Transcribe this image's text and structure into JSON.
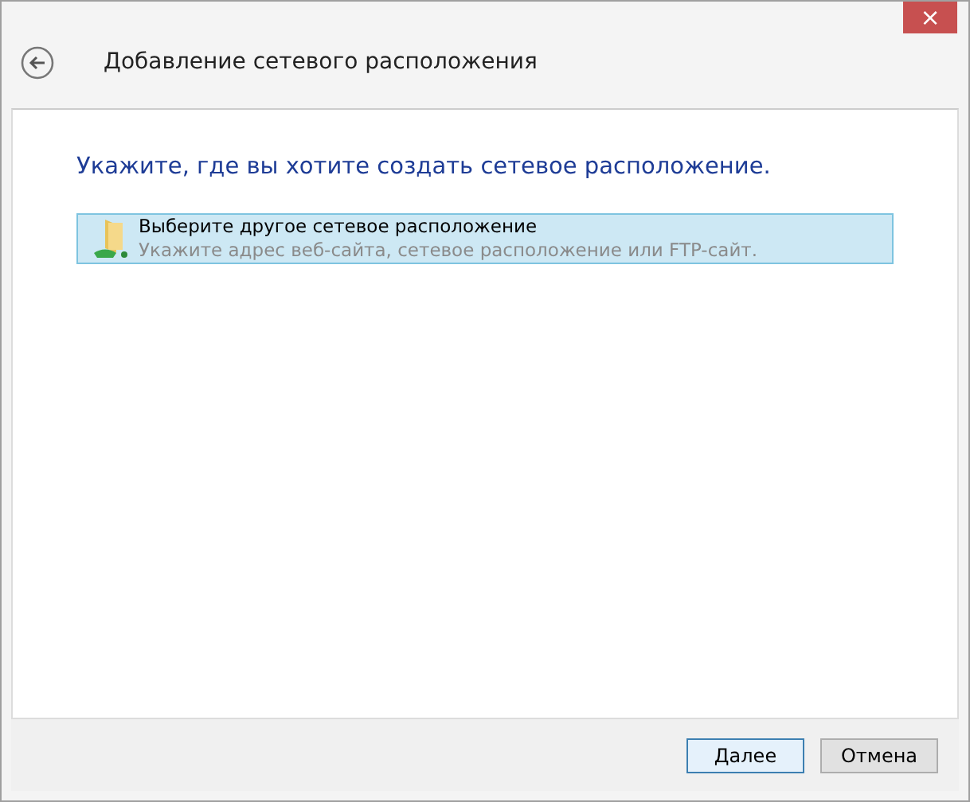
{
  "window": {
    "title": "Добавление сетевого расположения",
    "close": "×"
  },
  "heading": "Укажите, где вы хотите создать сетевое расположение.",
  "options": [
    {
      "title": "Выберите другое сетевое расположение",
      "description": "Укажите адрес веб-сайта, сетевое расположение или FTP-сайт.",
      "selected": true
    }
  ],
  "buttons": [
    {
      "label": "Далее",
      "default": true
    },
    {
      "label": "Отмена",
      "default": false
    }
  ]
}
